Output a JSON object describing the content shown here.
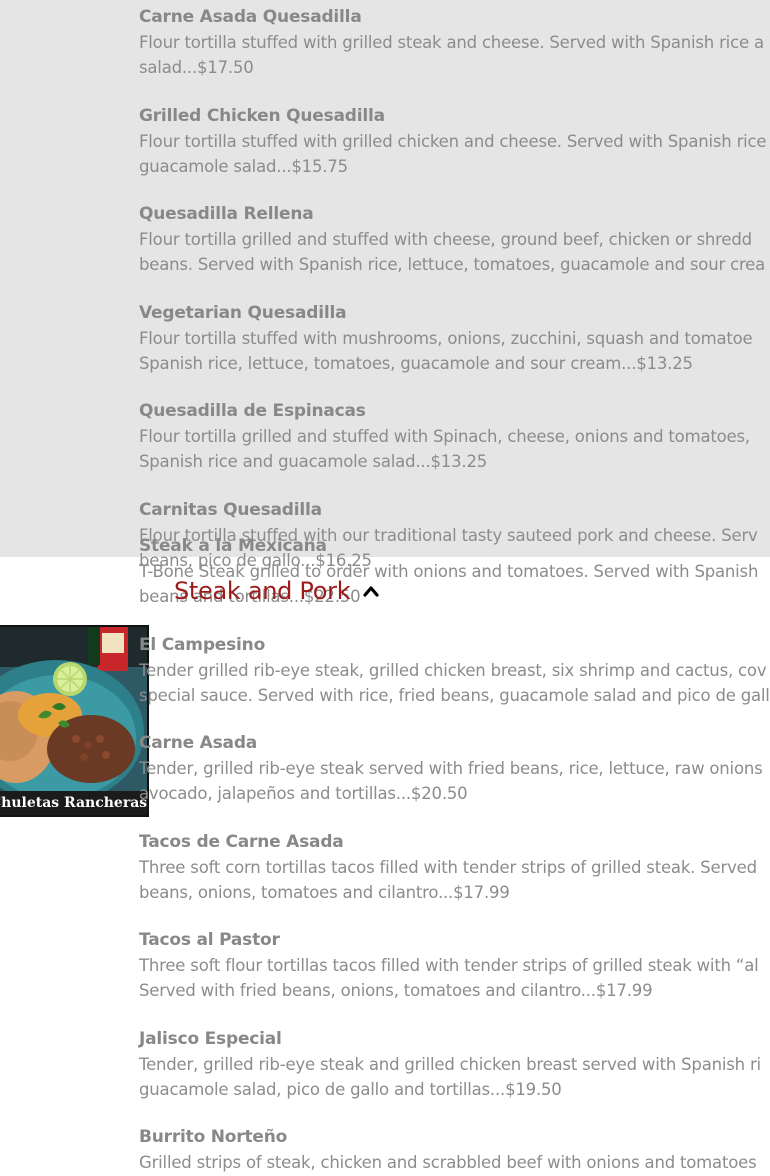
{
  "quesadillas": {
    "items": [
      {
        "name": "Carne Asada Quesadilla",
        "description": "Flour tortilla stuffed with grilled steak and cheese. Served with Spanish rice a\nsalad...$17.50"
      },
      {
        "name": "Grilled Chicken Quesadilla",
        "description": "Flour tortilla stuffed with grilled chicken and cheese. Served with Spanish rice\nguacamole salad...$15.75"
      },
      {
        "name": "Quesadilla Rellena",
        "description": "Flour tortilla grilled and stuffed with cheese, ground beef, chicken or shredd\nbeans. Served with Spanish rice, lettuce, tomatoes, guacamole and sour crea"
      },
      {
        "name": "Vegetarian Quesadilla",
        "description": "Flour tortilla stuffed with mushrooms, onions, zucchini, squash and tomatoe\nSpanish rice, lettuce, tomatoes, guacamole and sour cream...$13.25"
      },
      {
        "name": "Quesadilla de Espinacas",
        "description": "Flour tortilla grilled and stuffed with Spinach, cheese, onions and tomatoes,\nSpanish rice and guacamole salad...$13.25"
      },
      {
        "name": "Carnitas Quesadilla",
        "description": "Flour tortilla stuffed with our traditional tasty sauteed pork and cheese. Serv\nbeans, pico de gallo...$16.25"
      }
    ]
  },
  "steak_and_pork": {
    "title": "Steak and Pork",
    "chevron_icon": "chevron-up-icon",
    "image_caption": "Chuletas Rancheras",
    "items": [
      {
        "name": "Steak a la Mexicana",
        "description": "T-Bone Steak grilled to order with onions and tomatoes. Served with Spanish\nbeans and tortillas...$22.50"
      },
      {
        "name": "El Campesino",
        "description": "Tender grilled rib-eye steak, grilled chicken breast, six shrimp and cactus, cov\nspecial sauce. Served with rice, fried beans, guacamole salad and pico de gall"
      },
      {
        "name": "Carne Asada",
        "description": "Tender, grilled rib-eye steak served with fried beans, rice, lettuce, raw onions\navocado, jalapeños and tortillas...$20.50"
      },
      {
        "name": "Tacos de Carne Asada",
        "description": "Three soft corn tortillas tacos filled with tender strips of grilled steak. Served\nbeans, onions, tomatoes and cilantro...$17.99"
      },
      {
        "name": "Tacos al Pastor",
        "description": "Three soft flour tortillas tacos filled with tender strips of grilled steak with “al\nServed with fried beans, onions, tomatoes and cilantro...$17.99"
      },
      {
        "name": "Jalisco Especial",
        "description": "Tender, grilled rib-eye steak and grilled chicken breast served with Spanish ri\nguacamole salad, pico de gallo and tortillas...$19.50"
      },
      {
        "name": "Burrito Norteño",
        "description": "Grilled strips of steak, chicken and scrabbled beef with onions and tomatoes"
      }
    ]
  },
  "colors": {
    "accent": "#9b1b1b",
    "overlay": "#e5e5e5",
    "text": "#8a8a8a"
  }
}
